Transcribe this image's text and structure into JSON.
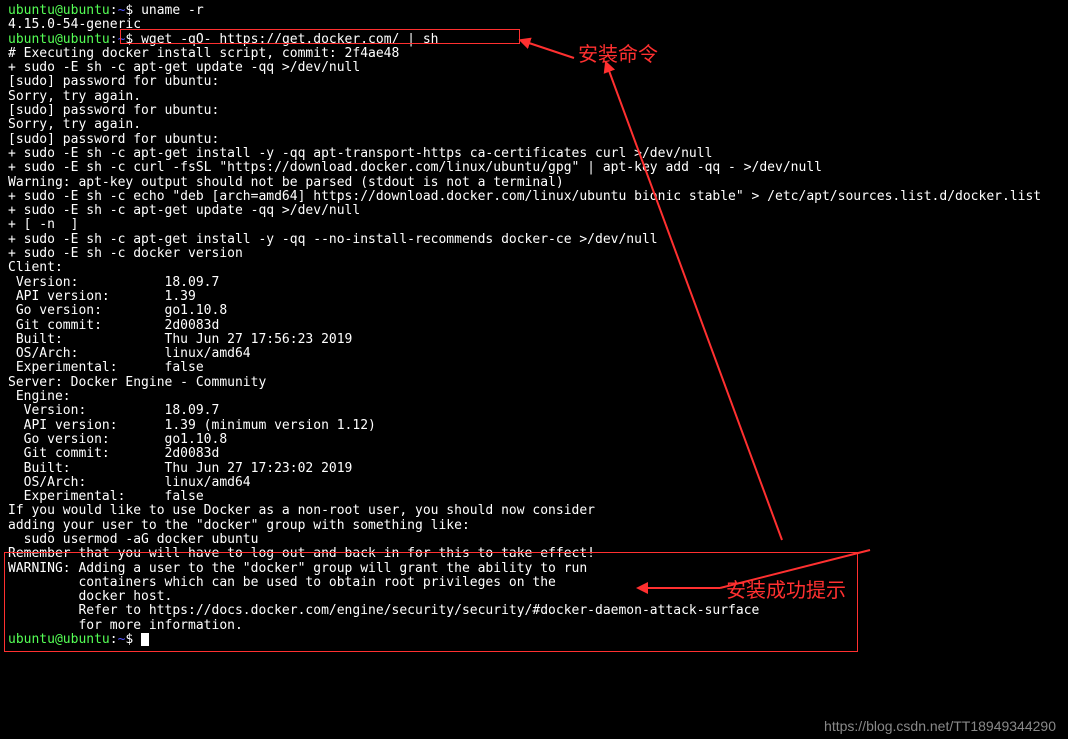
{
  "prompt1": {
    "user": "ubuntu@ubuntu",
    "colon": ":",
    "path": "~",
    "dollar": "$ ",
    "cmd": "uname -r"
  },
  "kernel": "4.15.0-54-generic",
  "prompt2": {
    "user": "ubuntu@ubuntu",
    "colon": ":",
    "path": "~",
    "dollar": "$ ",
    "cmd": "wget -qO- https://get.docker.com/ | sh"
  },
  "lines": [
    "# Executing docker install script, commit: 2f4ae48",
    "+ sudo -E sh -c apt-get update -qq >/dev/null",
    "[sudo] password for ubuntu:",
    "",
    "Sorry, try again.",
    "[sudo] password for ubuntu:",
    "Sorry, try again.",
    "[sudo] password for ubuntu:",
    "+ sudo -E sh -c apt-get install -y -qq apt-transport-https ca-certificates curl >/dev/null",
    "+ sudo -E sh -c curl -fsSL \"https://download.docker.com/linux/ubuntu/gpg\" | apt-key add -qq - >/dev/null",
    "Warning: apt-key output should not be parsed (stdout is not a terminal)",
    "+ sudo -E sh -c echo \"deb [arch=amd64] https://download.docker.com/linux/ubuntu bionic stable\" > /etc/apt/sources.list.d/docker.list",
    "+ sudo -E sh -c apt-get update -qq >/dev/null",
    "+ [ -n  ]",
    "+ sudo -E sh -c apt-get install -y -qq --no-install-recommends docker-ce >/dev/null",
    "+ sudo -E sh -c docker version",
    "Client:",
    " Version:           18.09.7",
    " API version:       1.39",
    " Go version:        go1.10.8",
    " Git commit:        2d0083d",
    " Built:             Thu Jun 27 17:56:23 2019",
    " OS/Arch:           linux/amd64",
    " Experimental:      false",
    "",
    "Server: Docker Engine - Community",
    " Engine:",
    "  Version:          18.09.7",
    "  API version:      1.39 (minimum version 1.12)",
    "  Go version:       go1.10.8",
    "  Git commit:       2d0083d",
    "  Built:            Thu Jun 27 17:23:02 2019",
    "  OS/Arch:          linux/amd64",
    "  Experimental:     false",
    "If you would like to use Docker as a non-root user, you should now consider",
    "adding your user to the \"docker\" group with something like:",
    "",
    "  sudo usermod -aG docker ubuntu",
    "",
    "Remember that you will have to log out and back in for this to take effect!",
    "",
    "WARNING: Adding a user to the \"docker\" group will grant the ability to run",
    "         containers which can be used to obtain root privileges on the",
    "         docker host.",
    "         Refer to https://docs.docker.com/engine/security/security/#docker-daemon-attack-surface",
    "         for more information."
  ],
  "prompt3": {
    "user": "ubuntu@ubuntu",
    "colon": ":",
    "path": "~",
    "dollar": "$ "
  },
  "anno1": "安装命令",
  "anno2": "安装成功提示",
  "watermark": "https://blog.csdn.net/TT18949344290"
}
